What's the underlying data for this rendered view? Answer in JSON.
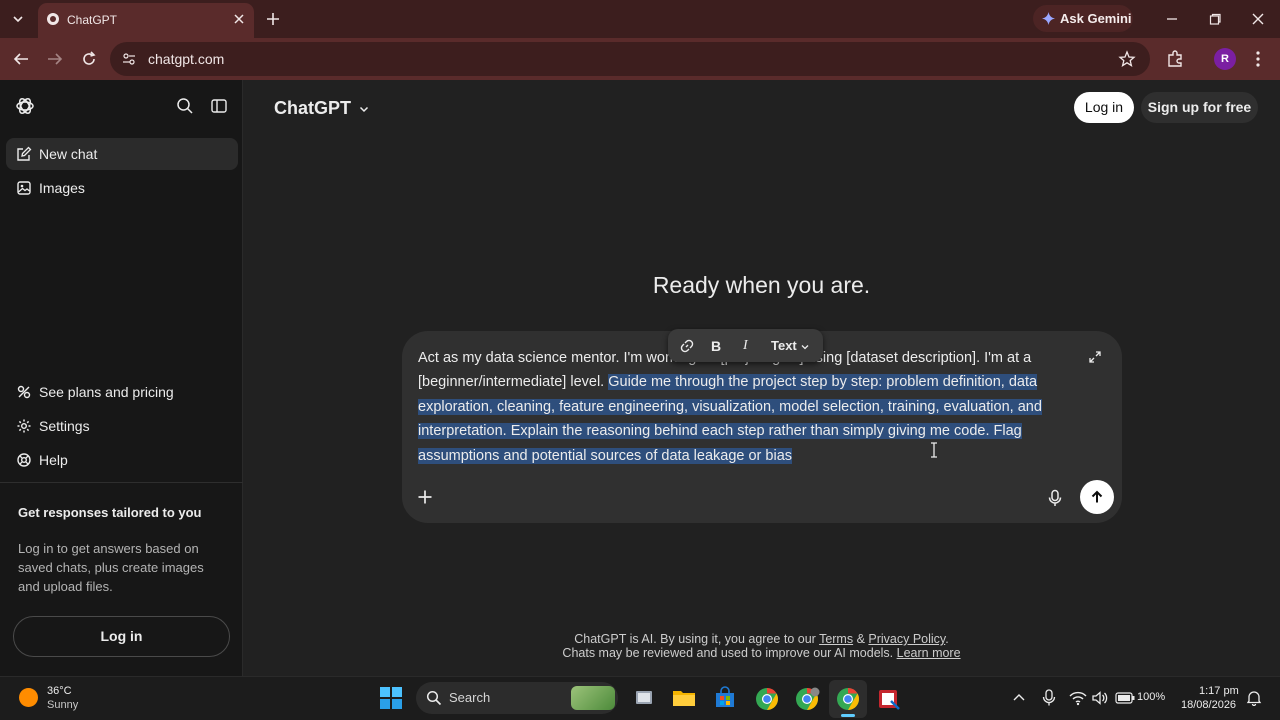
{
  "browser": {
    "tab_title": "ChatGPT",
    "url": "chatgpt.com",
    "ask_gemini": "Ask Gemini",
    "profile_initial": "R"
  },
  "sidebar": {
    "items_top": [
      {
        "label": "New chat",
        "icon": "edit-icon"
      },
      {
        "label": "Images",
        "icon": "images-icon"
      }
    ],
    "items_bottom": [
      {
        "label": "See plans and pricing",
        "icon": "plans-icon"
      },
      {
        "label": "Settings",
        "icon": "gear-icon"
      },
      {
        "label": "Help",
        "icon": "help-icon"
      }
    ],
    "promo_heading": "Get responses tailored to you",
    "promo_text": "Log in to get answers based on saved chats, plus create images and upload files.",
    "login_label": "Log in"
  },
  "header": {
    "model_name": "ChatGPT",
    "login_label": "Log in",
    "signup_label": "Sign up for free"
  },
  "main": {
    "headline": "Ready when you are.",
    "prompt_unselected": "Act as my data science mentor. I'm working on [project goal] using [dataset description]. I'm at a [beginner/intermediate] level. ",
    "prompt_selected": "Guide me through the project step by step: problem definition, data exploration, cleaning, feature engineering, visualization, model selection, training, evaluation, and interpretation. Explain the reasoning behind each step rather than simply giving me code. Flag assumptions and potential sources of data leakage or bias",
    "format_text_label": "Text"
  },
  "footer": {
    "line1_prefix": "ChatGPT is AI. By using it, you agree to our ",
    "terms": "Terms",
    "amp": " & ",
    "privacy": "Privacy Policy",
    "line1_suffix": ".",
    "line2_prefix": "Chats may be reviewed and used to improve our AI models. ",
    "learn_more": "Learn more"
  },
  "taskbar": {
    "temperature": "36°C",
    "condition": "Sunny",
    "search_label": "Search",
    "battery": "100%",
    "time": "1:17 pm",
    "date": "18/08/2026"
  },
  "colors": {
    "tab_bar": "#3c1e1e",
    "toolbar": "#5a2b2b",
    "sidebar": "#171717",
    "main_bg": "#212121",
    "composer": "#303030",
    "selection": "#2e4e7c"
  }
}
